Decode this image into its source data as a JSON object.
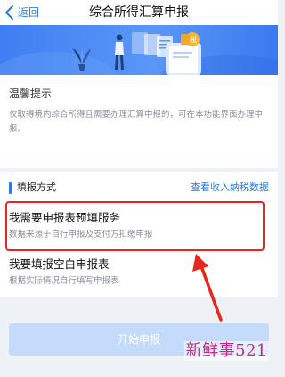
{
  "nav": {
    "back_label": "返回",
    "title": "综合所得汇算申报"
  },
  "notice": {
    "title": "温馨提示",
    "body": "仅取得境内综合所得且需要办理汇算申报的，可在本功能界面办理申报。"
  },
  "method": {
    "section_title": "填报方式",
    "link_label": "查看收入纳税数据",
    "options": [
      {
        "title": "我需要申报表预填服务",
        "desc": "数据来源于自行申报及支付方扣缴申报"
      },
      {
        "title": "我要填报空白申报表",
        "desc": "根据实际情况自行填写申报表"
      }
    ]
  },
  "footer": {
    "start_label": "开始申报"
  },
  "watermark": "新鲜事521",
  "colors": {
    "accent": "#2a7be4",
    "highlight": "#e8261c",
    "banner": "#4a88f3",
    "button_disabled": "#c5dbfb",
    "watermark": "#c22a86"
  },
  "icons": {
    "back": "chevron-left-icon"
  }
}
